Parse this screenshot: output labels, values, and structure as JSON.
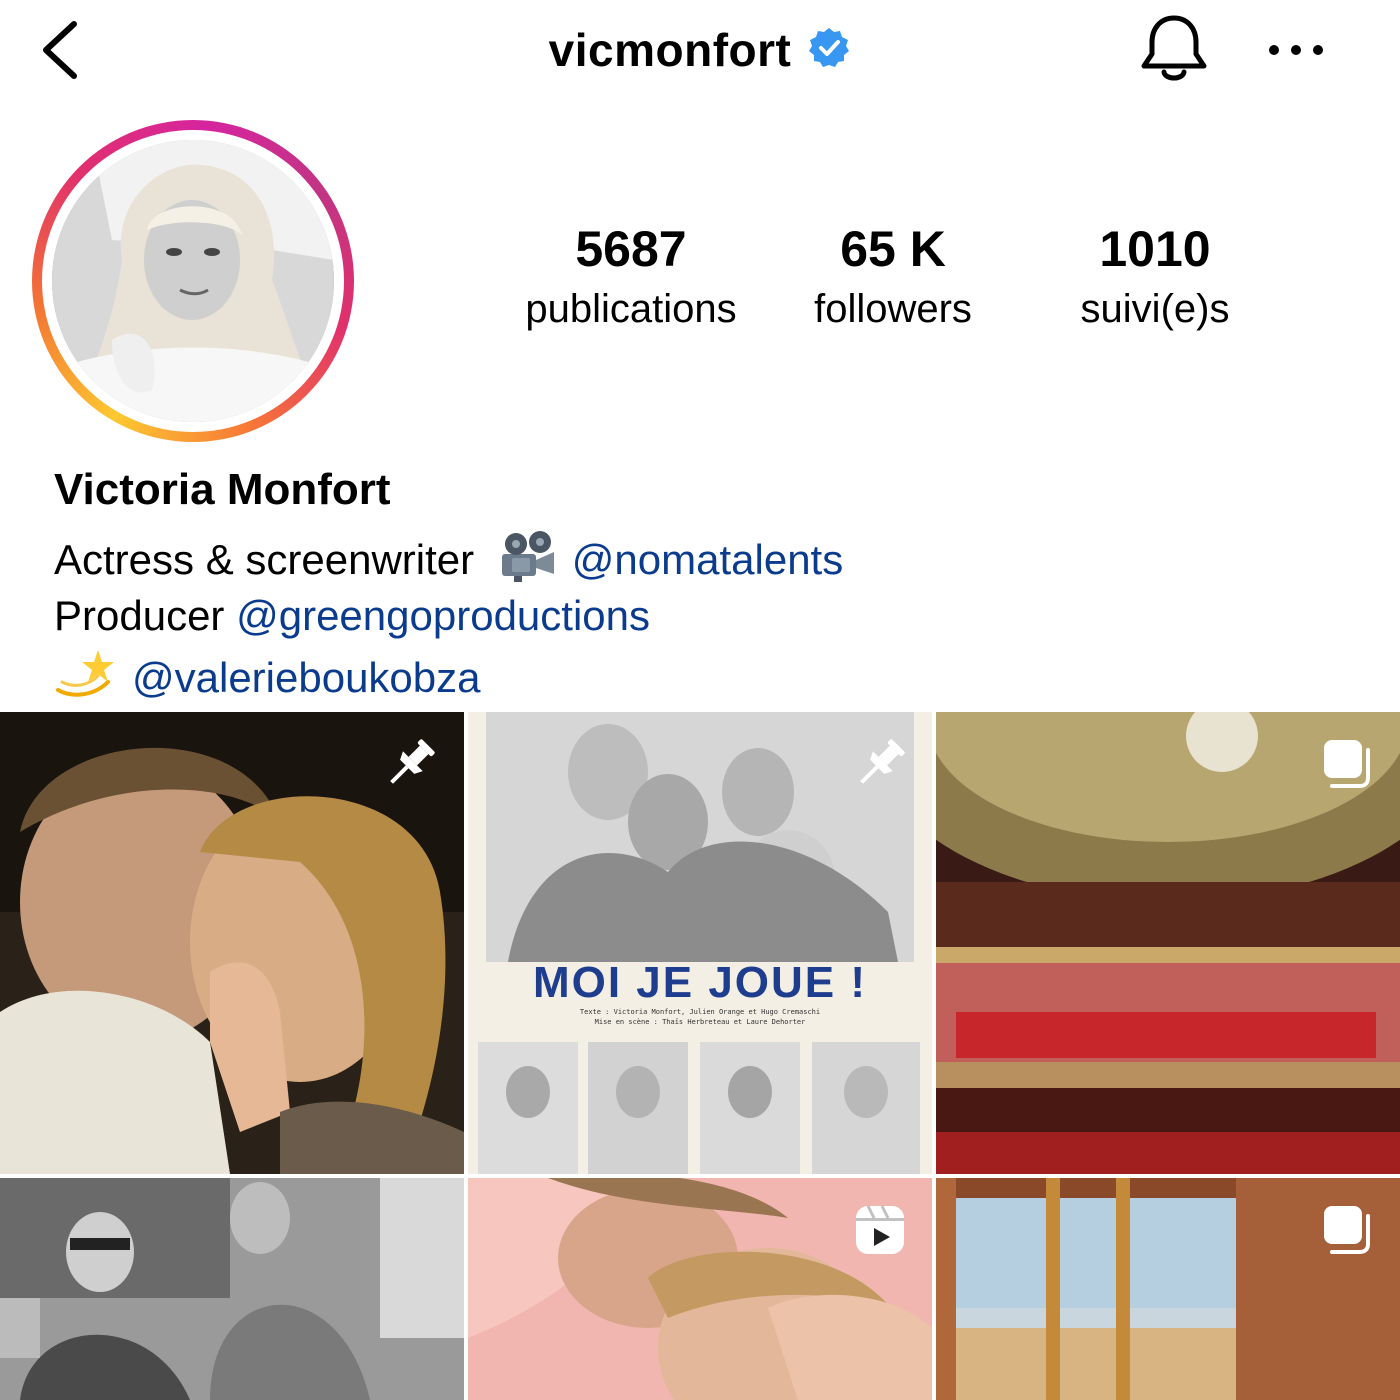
{
  "header": {
    "username": "vicmonfort",
    "verified": true,
    "icons": {
      "back": "chevron-left-icon",
      "bell": "bell-icon",
      "more": "ellipsis-icon",
      "verified": "verified-badge-icon"
    }
  },
  "stats": [
    {
      "value": "5687",
      "label": "publications"
    },
    {
      "value": "65 K",
      "label": "followers"
    },
    {
      "value": "1010",
      "label": "suivi(e)s"
    }
  ],
  "bio": {
    "name": "Victoria Monfort",
    "line1_text": "Actress & screenwriter",
    "line1_emoji": "film-projector",
    "line1_mention": "@nomatalents",
    "line2_text": "Producer",
    "line2_mention": "@greengoproductions",
    "line3_emoji": "dizzy",
    "line3_mention": "@valerieboukobza",
    "mention_color": "#0b3b8c"
  },
  "grid": {
    "posts": [
      {
        "kind": "photo",
        "badge": "pin-icon"
      },
      {
        "kind": "poster",
        "badge": "pin-icon",
        "poster_title": "MOI JE JOUE !",
        "poster_credit_1": "Texte : Victoria Monfort, Julien Orange et Hugo Cremaschi",
        "poster_credit_2": "Mise en scène : Thaïs Herbreteau et Laure Dehorter"
      },
      {
        "kind": "carousel",
        "badge": "carousel-icon"
      },
      {
        "kind": "photo",
        "badge": ""
      },
      {
        "kind": "reel",
        "badge": "reel-icon"
      },
      {
        "kind": "carousel",
        "badge": "carousel-icon"
      }
    ]
  }
}
